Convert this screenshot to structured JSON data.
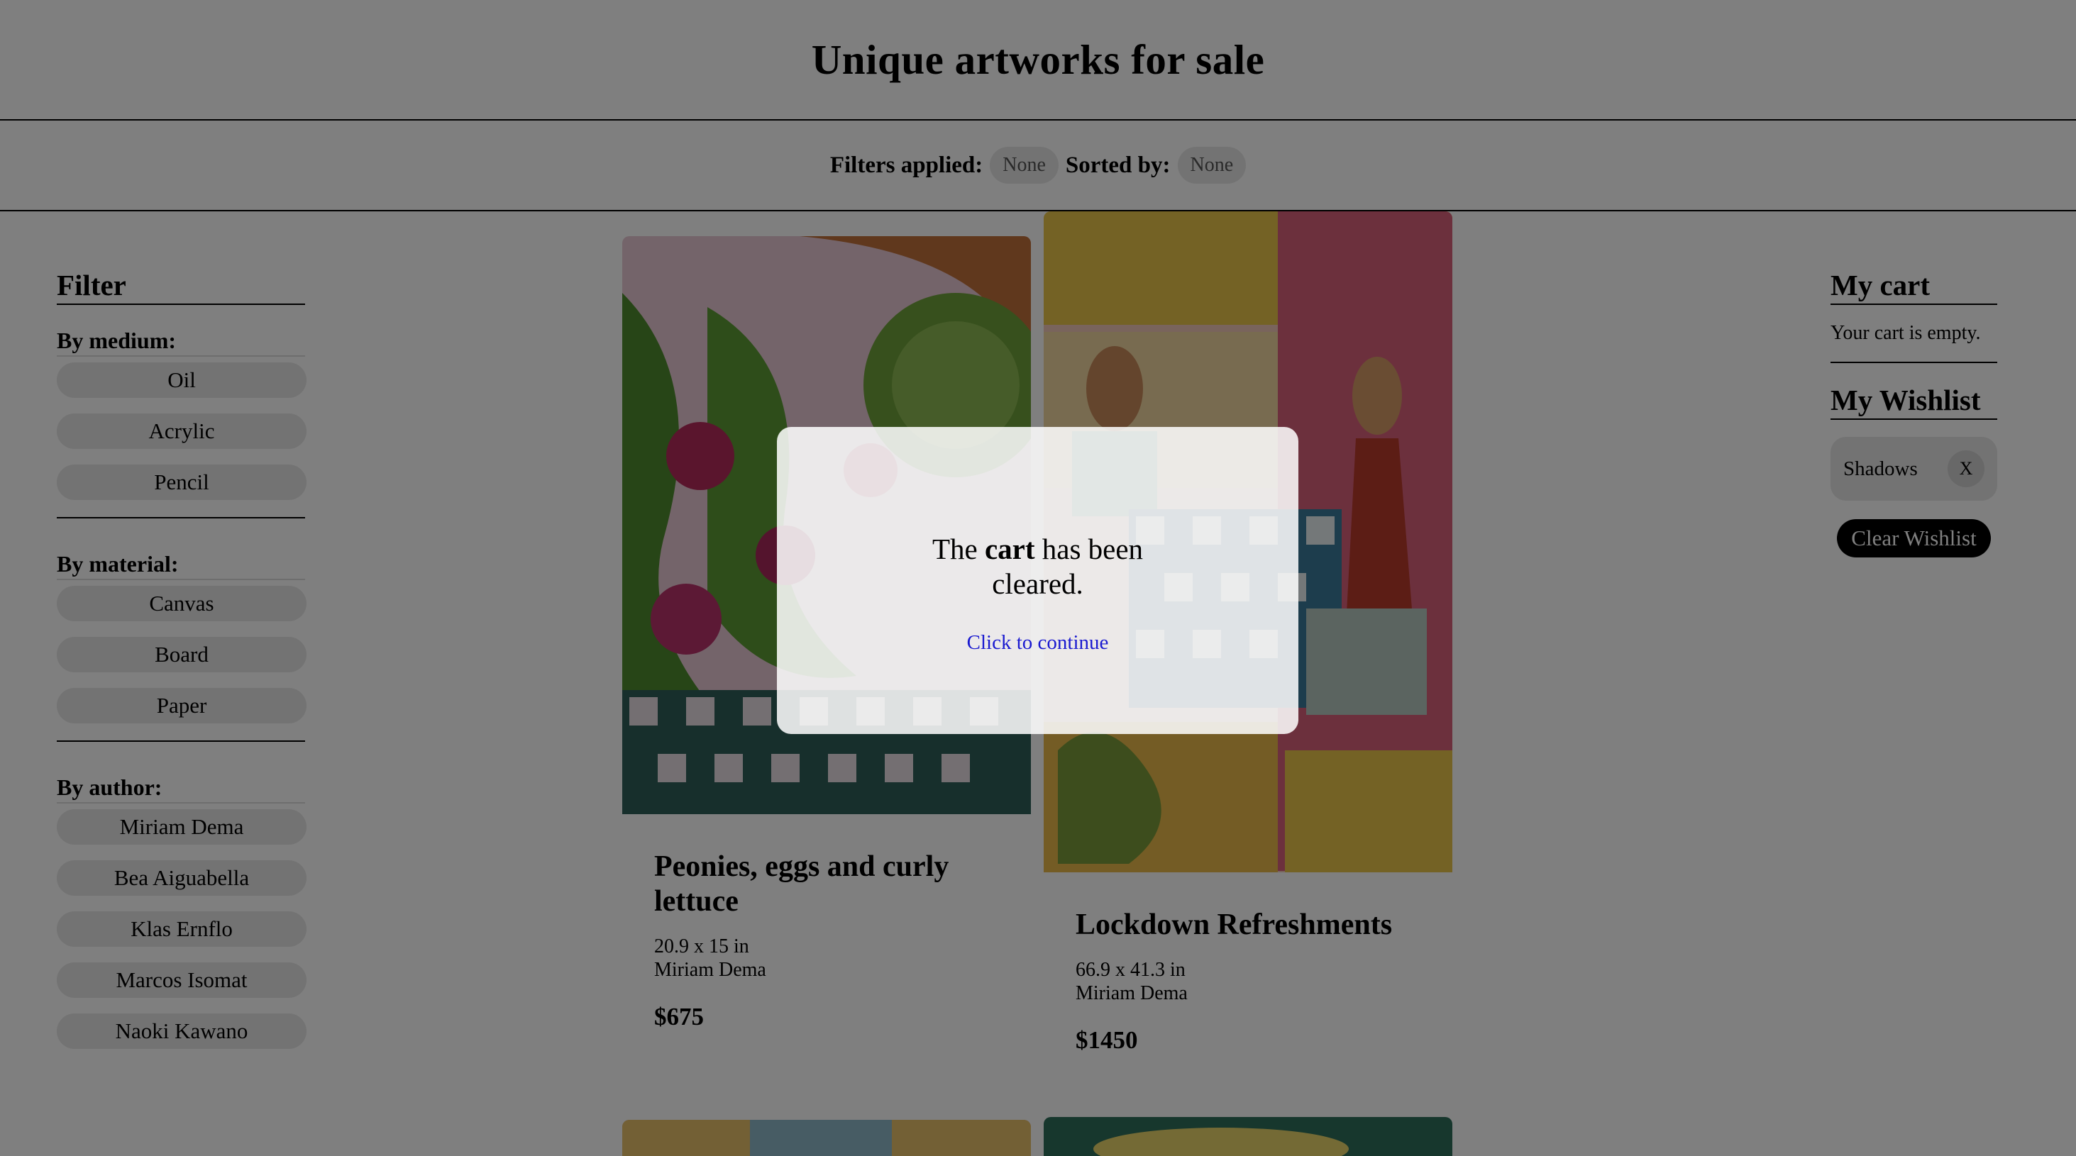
{
  "header": {
    "title": "Unique artworks for sale"
  },
  "filterbar": {
    "filters_label": "Filters applied:",
    "filters_value": "None",
    "sorted_label": "Sorted by:",
    "sorted_value": "None"
  },
  "sidebar": {
    "title": "Filter",
    "medium": {
      "heading": "By medium:",
      "options": [
        "Oil",
        "Acrylic",
        "Pencil"
      ]
    },
    "material": {
      "heading": "By material:",
      "options": [
        "Canvas",
        "Board",
        "Paper"
      ]
    },
    "author": {
      "heading": "By author:",
      "options": [
        "Miriam Dema",
        "Bea Aiguabella",
        "Klas Ernflo",
        "Marcos Isomat",
        "Naoki Kawano"
      ]
    }
  },
  "cards": [
    {
      "title": "Peonies, eggs and curly lettuce",
      "size": "20.9 x 15 in",
      "author": "Miriam Dema",
      "price": "$675"
    },
    {
      "title": "Lockdown Refreshments",
      "size": "66.9 x 41.3 in",
      "author": "Miriam Dema",
      "price": "$1450"
    }
  ],
  "cart": {
    "title": "My cart",
    "empty_text": "Your cart is empty."
  },
  "wishlist": {
    "title": "My Wishlist",
    "items": [
      {
        "name": "Shadows",
        "remove_label": "X"
      }
    ],
    "clear_label": "Clear Wishlist"
  },
  "modal": {
    "msg_pre": "The",
    "msg_bold": "cart",
    "msg_post": "has been",
    "msg_line2": "cleared.",
    "continue_label": "Click to continue"
  },
  "colors": {
    "overlay": "#808080",
    "link": "#1a1ad0",
    "chip": "#e6e6e6"
  },
  "icons": {
    "remove": "close-icon"
  }
}
